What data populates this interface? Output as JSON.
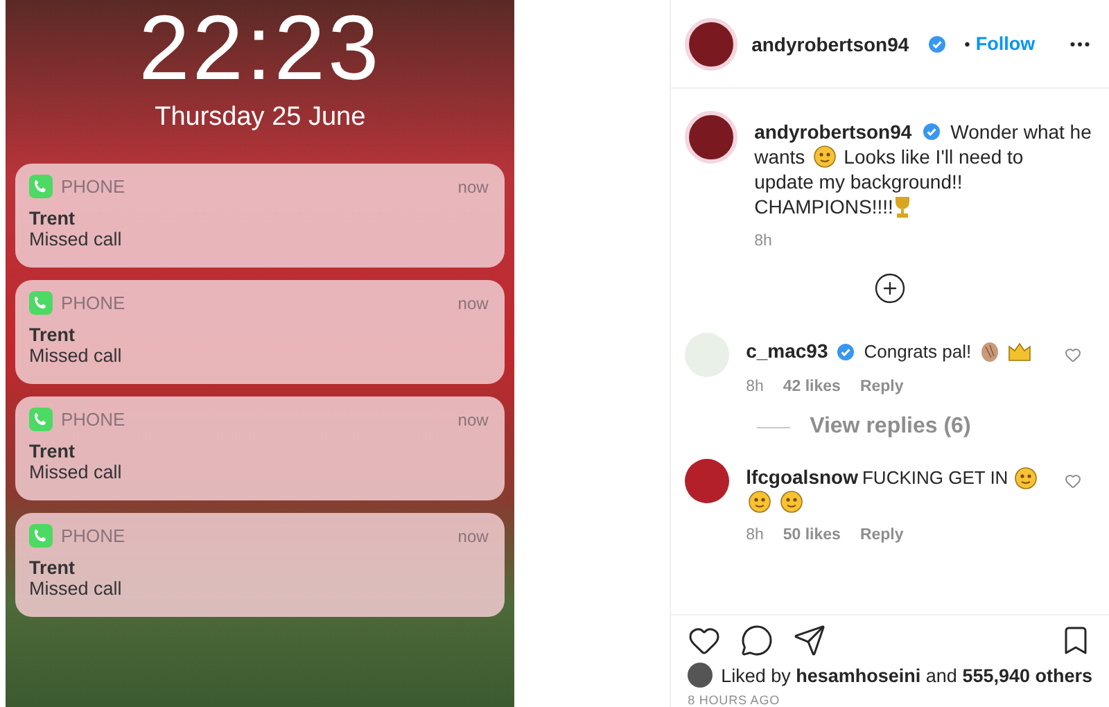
{
  "lock_screen": {
    "time": "22:23",
    "date": "Thursday 25 June",
    "notifications": [
      {
        "app": "PHONE",
        "time": "now",
        "title": "Trent",
        "body": "Missed call"
      },
      {
        "app": "PHONE",
        "time": "now",
        "title": "Trent",
        "body": "Missed call"
      },
      {
        "app": "PHONE",
        "time": "now",
        "title": "Trent",
        "body": "Missed call"
      },
      {
        "app": "PHONE",
        "time": "now",
        "title": "Trent",
        "body": "Missed call"
      }
    ]
  },
  "post": {
    "header": {
      "username": "andyrobertson94",
      "verified": true,
      "separator": "•",
      "follow": "Follow"
    },
    "caption": {
      "username": "andyrobertson94",
      "verified": true,
      "lines": [
        "Wonder what he",
        "wants",
        "Looks like I'll need to",
        "update my background!!",
        "CHAMPIONS!!!!"
      ],
      "time": "8h"
    },
    "comments": [
      {
        "username": "c_mac93",
        "verified": true,
        "text": "Congrats pal!",
        "time": "8h",
        "likes": "42 likes",
        "reply": "Reply",
        "view_replies": "View replies (6)",
        "liked": false
      },
      {
        "username": "lfcgoalsnow",
        "verified": false,
        "text": "FUCKING GET IN",
        "time": "8h",
        "likes": "50 likes",
        "reply": "Reply",
        "liked": false
      }
    ],
    "liked_by": "Liked by **hesamhoseini** and **555,940 others**",
    "age": "8 HOURS AGO"
  }
}
